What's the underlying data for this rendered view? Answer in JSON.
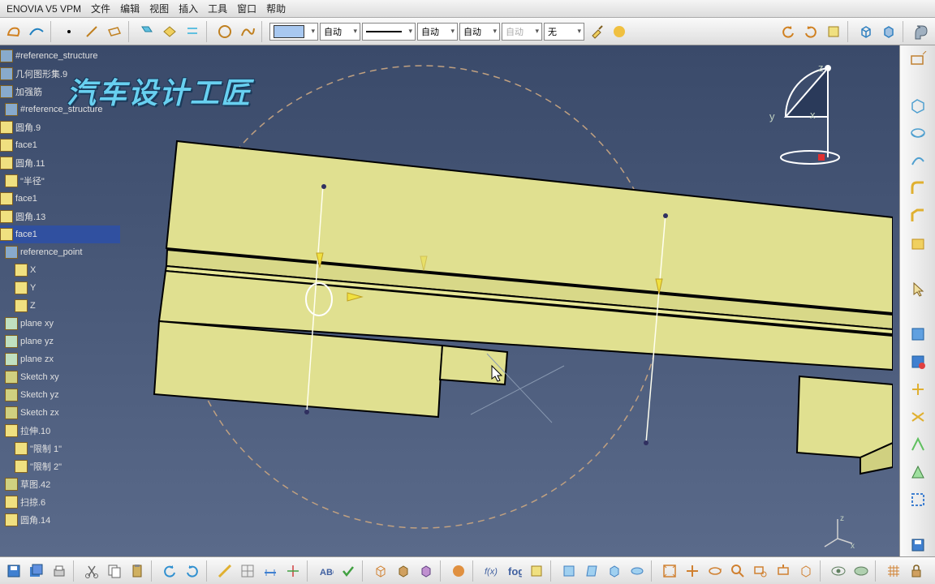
{
  "app": {
    "title": "ENOVIA V5 VPM"
  },
  "menus": [
    "文件",
    "编辑",
    "视图",
    "插入",
    "工具",
    "窗口",
    "帮助"
  ],
  "top_dropdowns": {
    "auto1": "自动",
    "auto2": "自动",
    "auto3": "自动",
    "auto4": "自动",
    "none": "无"
  },
  "watermark": "汽车设计工匠",
  "tree": [
    {
      "label": "#reference_structure",
      "icon": "struct",
      "indent": 0
    },
    {
      "label": "几何图形集.9",
      "icon": "struct",
      "indent": 0
    },
    {
      "label": "加强筋",
      "icon": "struct",
      "indent": 0
    },
    {
      "label": "#reference_structure",
      "icon": "struct",
      "indent": 1
    },
    {
      "label": "圆角.9",
      "icon": "param",
      "indent": 0
    },
    {
      "label": "face1",
      "icon": "param",
      "indent": 0
    },
    {
      "label": "圆角.11",
      "icon": "param",
      "indent": 0
    },
    {
      "label": "\"半径\"",
      "icon": "param",
      "indent": 1
    },
    {
      "label": "face1",
      "icon": "param",
      "indent": 0
    },
    {
      "label": "圆角.13",
      "icon": "param",
      "indent": 0
    },
    {
      "label": "face1",
      "icon": "param",
      "indent": 0,
      "highlight": true
    },
    {
      "label": "reference_point",
      "icon": "struct",
      "indent": 1
    },
    {
      "label": "X",
      "icon": "param",
      "indent": 2
    },
    {
      "label": "Y",
      "icon": "param",
      "indent": 2
    },
    {
      "label": "Z",
      "icon": "param",
      "indent": 2
    },
    {
      "label": "plane xy",
      "icon": "plane",
      "indent": 1
    },
    {
      "label": "plane yz",
      "icon": "plane",
      "indent": 1
    },
    {
      "label": "plane zx",
      "icon": "plane",
      "indent": 1
    },
    {
      "label": "Sketch xy",
      "icon": "sketch",
      "indent": 1
    },
    {
      "label": "Sketch yz",
      "icon": "sketch",
      "indent": 1
    },
    {
      "label": "Sketch zx",
      "icon": "sketch",
      "indent": 1
    },
    {
      "label": "拉伸.10",
      "icon": "param",
      "indent": 1
    },
    {
      "label": "\"限制 1\"",
      "icon": "param",
      "indent": 2
    },
    {
      "label": "\"限制 2\"",
      "icon": "param",
      "indent": 2
    },
    {
      "label": "草图.42",
      "icon": "sketch",
      "indent": 1
    },
    {
      "label": "扫掠.6",
      "icon": "param",
      "indent": 1
    },
    {
      "label": "圆角.14",
      "icon": "param",
      "indent": 1
    }
  ],
  "axes": {
    "x": "x",
    "y": "y",
    "z": "z"
  }
}
